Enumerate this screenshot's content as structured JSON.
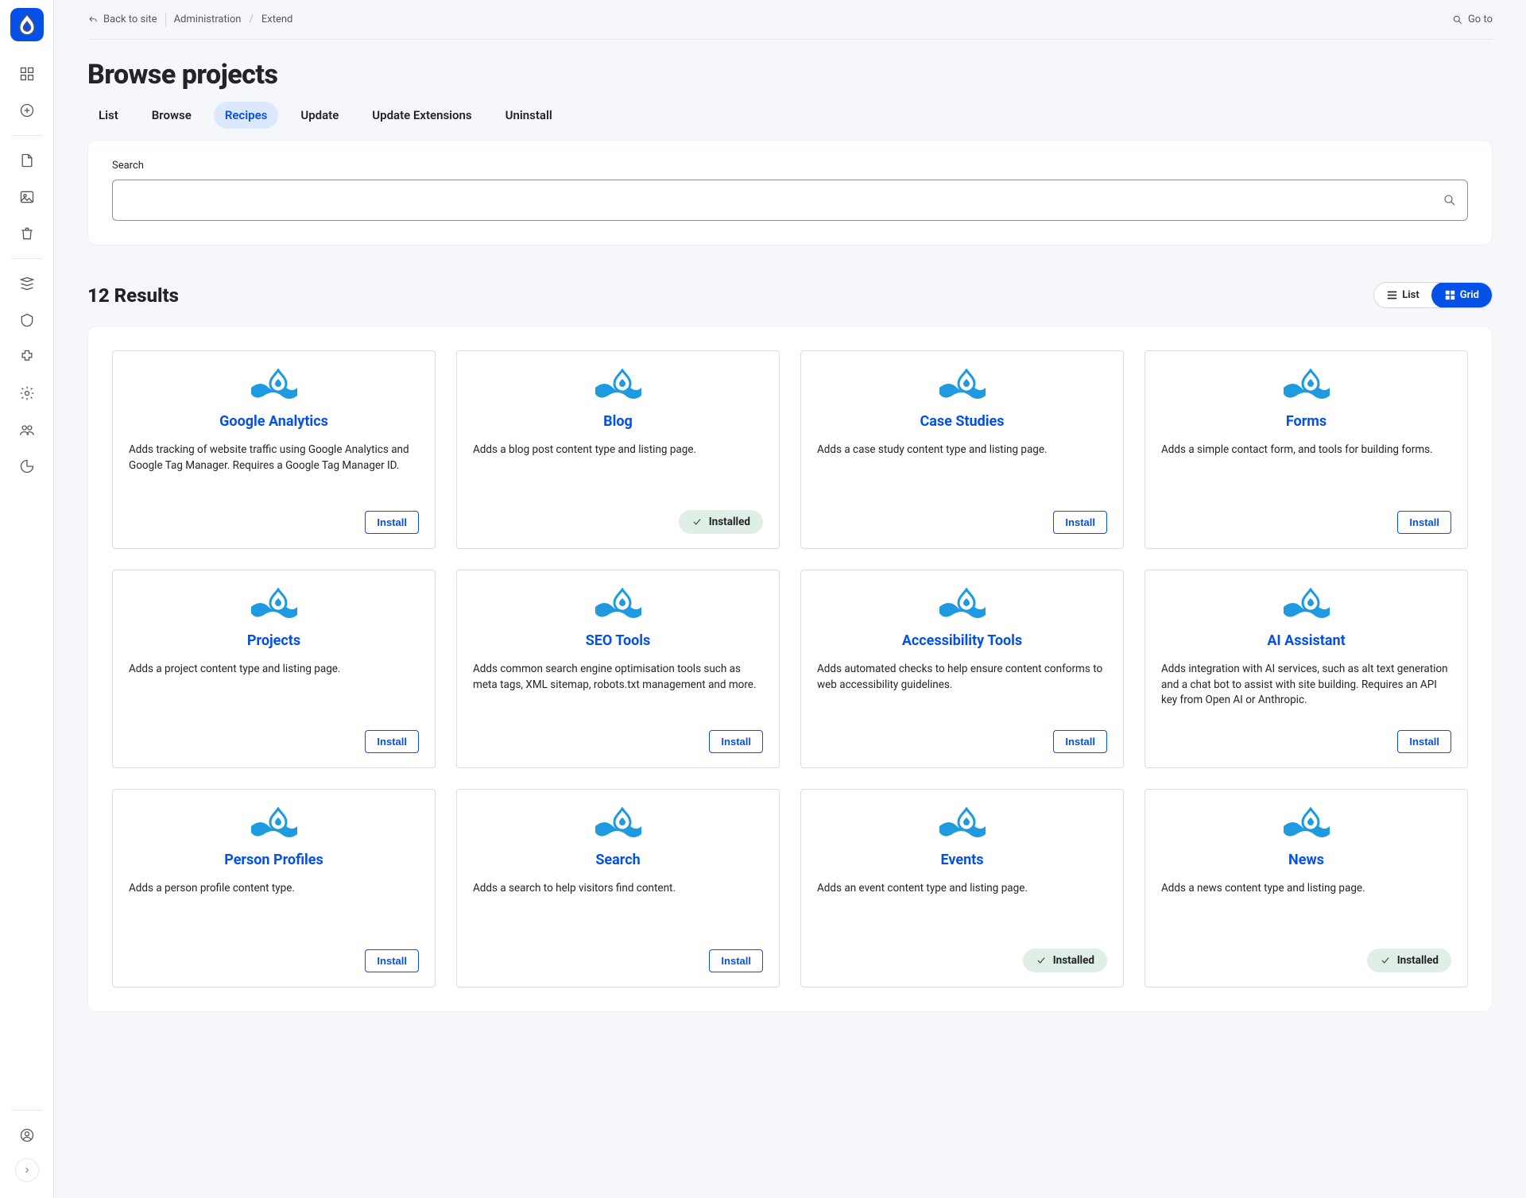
{
  "header": {
    "back_label": "Back to site",
    "crumb1": "Administration",
    "crumb2": "Extend",
    "goto_label": "Go to"
  },
  "page": {
    "title": "Browse projects",
    "search_label": "Search",
    "results_heading": "12 Results"
  },
  "tabs": [
    {
      "label": "List",
      "active": false
    },
    {
      "label": "Browse",
      "active": false
    },
    {
      "label": "Recipes",
      "active": true
    },
    {
      "label": "Update",
      "active": false
    },
    {
      "label": "Update Extensions",
      "active": false
    },
    {
      "label": "Uninstall",
      "active": false
    }
  ],
  "view": {
    "list_label": "List",
    "grid_label": "Grid"
  },
  "buttons": {
    "install": "Install",
    "installed": "Installed"
  },
  "projects": [
    {
      "title": "Google Analytics",
      "desc": "Adds tracking of website traffic using Google Analytics and Google Tag Manager. Requires a Google Tag Manager ID.",
      "installed": false
    },
    {
      "title": "Blog",
      "desc": "Adds a blog post content type and listing page.",
      "installed": true
    },
    {
      "title": "Case Studies",
      "desc": "Adds a case study content type and listing page.",
      "installed": false
    },
    {
      "title": "Forms",
      "desc": "Adds a simple contact form, and tools for building forms.",
      "installed": false
    },
    {
      "title": "Projects",
      "desc": "Adds a project content type and listing page.",
      "installed": false
    },
    {
      "title": "SEO Tools",
      "desc": "Adds common search engine optimisation tools such as meta tags, XML sitemap, robots.txt management and more.",
      "installed": false
    },
    {
      "title": "Accessibility Tools",
      "desc": "Adds automated checks to help ensure content con­forms to web accessibility guidelines.",
      "installed": false
    },
    {
      "title": "AI Assistant",
      "desc": "Adds integration with AI services, such as alt text generation and a chat bot to assist with site building. Requires an API key from Open AI or Anthropic.",
      "installed": false
    },
    {
      "title": "Person Profiles",
      "desc": "Adds a person profile content type.",
      "installed": false
    },
    {
      "title": "Search",
      "desc": "Adds a search to help visitors find content.",
      "installed": false
    },
    {
      "title": "Events",
      "desc": "Adds an event content type and listing page.",
      "installed": true
    },
    {
      "title": "News",
      "desc": "Adds a news content type and listing page.",
      "installed": true
    }
  ]
}
